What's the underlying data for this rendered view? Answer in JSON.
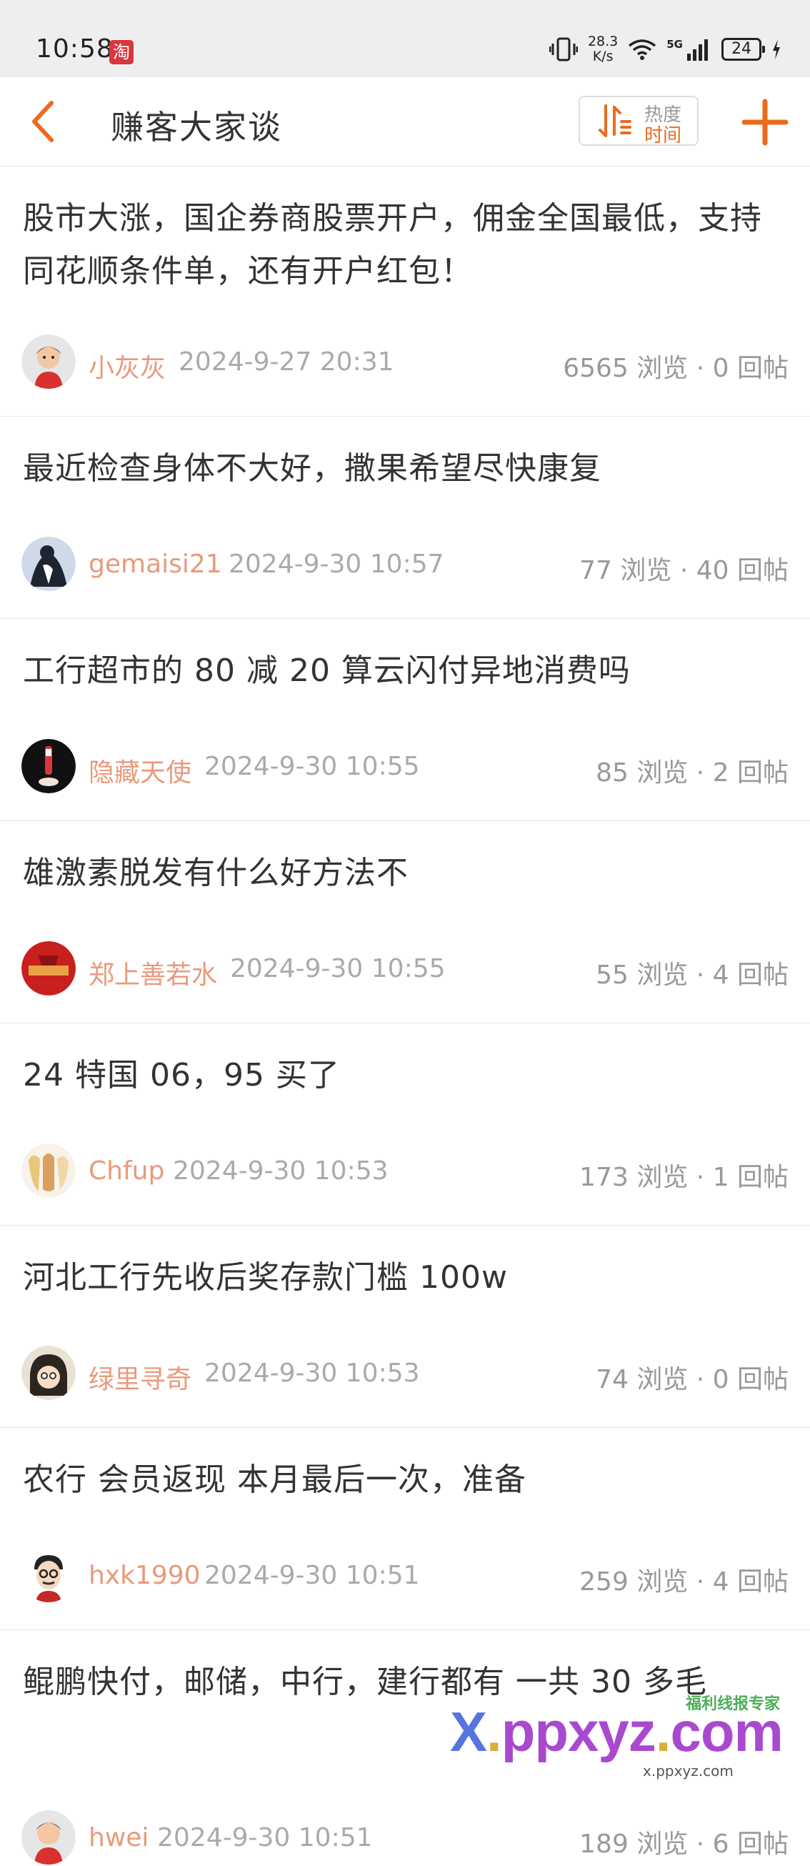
{
  "status_bar": {
    "time": "10:58",
    "taobao_badge": "淘",
    "net_speed_value": "28.3",
    "net_speed_unit": "K/s",
    "signal_label": "5G",
    "battery": "24"
  },
  "header": {
    "title": "赚客大家谈",
    "sort_option_hot": "热度",
    "sort_option_time": "时间",
    "accent_color": "#ec6b1d"
  },
  "posts": [
    {
      "title": "股市大涨，国企券商股票开户，佣金全国最低，支持同花顺条件单，还有开户红包！",
      "author": "小灰灰",
      "time": "2024-9-27 20:31",
      "stats": "6565 浏览 · 0 回帖"
    },
    {
      "title": "最近检查身体不大好，撒果希望尽快康复",
      "author": "gemaisi21",
      "time": "2024-9-30 10:57",
      "stats": "77 浏览 · 40 回帖"
    },
    {
      "title": "工行超市的 80 减 20 算云闪付异地消费吗",
      "author": "隐藏天使",
      "time": "2024-9-30 10:55",
      "stats": "85 浏览 · 2 回帖"
    },
    {
      "title": "雄激素脱发有什么好方法不",
      "author": "郑上善若水",
      "time": "2024-9-30 10:55",
      "stats": "55 浏览 · 4 回帖"
    },
    {
      "title": "24 特国 06，95 买了",
      "author": "Chfup",
      "time": "2024-9-30 10:53",
      "stats": "173 浏览 · 1 回帖"
    },
    {
      "title": "河北工行先收后奖存款门槛 100w",
      "author": "绿里寻奇",
      "time": "2024-9-30 10:53",
      "stats": "74 浏览 · 0 回帖"
    },
    {
      "title": "农行 会员返现 本月最后一次，准备",
      "author": "hxk1990",
      "time": "2024-9-30 10:51",
      "stats": "259 浏览 · 4 回帖"
    },
    {
      "title": "鲲鹏快付，邮储，中行，建行都有 一共 30 多毛",
      "author": "hwei",
      "time": "2024-9-30 10:51",
      "stats": "189 浏览 · 6 回帖"
    }
  ],
  "watermark": {
    "brand_x": "X",
    "brand_dot": ".",
    "brand_rest1": "ppxyz",
    "brand_rest2": "com",
    "tagline": "福利线报专家",
    "sub_url": "x.ppxyz.com"
  }
}
